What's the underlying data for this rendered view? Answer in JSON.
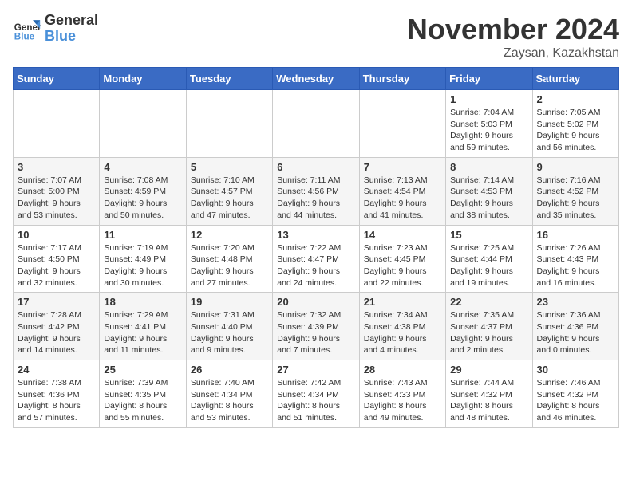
{
  "header": {
    "logo_line1": "General",
    "logo_line2": "Blue",
    "month": "November 2024",
    "location": "Zaysan, Kazakhstan"
  },
  "days_of_week": [
    "Sunday",
    "Monday",
    "Tuesday",
    "Wednesday",
    "Thursday",
    "Friday",
    "Saturday"
  ],
  "weeks": [
    [
      {
        "day": "",
        "info": ""
      },
      {
        "day": "",
        "info": ""
      },
      {
        "day": "",
        "info": ""
      },
      {
        "day": "",
        "info": ""
      },
      {
        "day": "",
        "info": ""
      },
      {
        "day": "1",
        "info": "Sunrise: 7:04 AM\nSunset: 5:03 PM\nDaylight: 9 hours and 59 minutes."
      },
      {
        "day": "2",
        "info": "Sunrise: 7:05 AM\nSunset: 5:02 PM\nDaylight: 9 hours and 56 minutes."
      }
    ],
    [
      {
        "day": "3",
        "info": "Sunrise: 7:07 AM\nSunset: 5:00 PM\nDaylight: 9 hours and 53 minutes."
      },
      {
        "day": "4",
        "info": "Sunrise: 7:08 AM\nSunset: 4:59 PM\nDaylight: 9 hours and 50 minutes."
      },
      {
        "day": "5",
        "info": "Sunrise: 7:10 AM\nSunset: 4:57 PM\nDaylight: 9 hours and 47 minutes."
      },
      {
        "day": "6",
        "info": "Sunrise: 7:11 AM\nSunset: 4:56 PM\nDaylight: 9 hours and 44 minutes."
      },
      {
        "day": "7",
        "info": "Sunrise: 7:13 AM\nSunset: 4:54 PM\nDaylight: 9 hours and 41 minutes."
      },
      {
        "day": "8",
        "info": "Sunrise: 7:14 AM\nSunset: 4:53 PM\nDaylight: 9 hours and 38 minutes."
      },
      {
        "day": "9",
        "info": "Sunrise: 7:16 AM\nSunset: 4:52 PM\nDaylight: 9 hours and 35 minutes."
      }
    ],
    [
      {
        "day": "10",
        "info": "Sunrise: 7:17 AM\nSunset: 4:50 PM\nDaylight: 9 hours and 32 minutes."
      },
      {
        "day": "11",
        "info": "Sunrise: 7:19 AM\nSunset: 4:49 PM\nDaylight: 9 hours and 30 minutes."
      },
      {
        "day": "12",
        "info": "Sunrise: 7:20 AM\nSunset: 4:48 PM\nDaylight: 9 hours and 27 minutes."
      },
      {
        "day": "13",
        "info": "Sunrise: 7:22 AM\nSunset: 4:47 PM\nDaylight: 9 hours and 24 minutes."
      },
      {
        "day": "14",
        "info": "Sunrise: 7:23 AM\nSunset: 4:45 PM\nDaylight: 9 hours and 22 minutes."
      },
      {
        "day": "15",
        "info": "Sunrise: 7:25 AM\nSunset: 4:44 PM\nDaylight: 9 hours and 19 minutes."
      },
      {
        "day": "16",
        "info": "Sunrise: 7:26 AM\nSunset: 4:43 PM\nDaylight: 9 hours and 16 minutes."
      }
    ],
    [
      {
        "day": "17",
        "info": "Sunrise: 7:28 AM\nSunset: 4:42 PM\nDaylight: 9 hours and 14 minutes."
      },
      {
        "day": "18",
        "info": "Sunrise: 7:29 AM\nSunset: 4:41 PM\nDaylight: 9 hours and 11 minutes."
      },
      {
        "day": "19",
        "info": "Sunrise: 7:31 AM\nSunset: 4:40 PM\nDaylight: 9 hours and 9 minutes."
      },
      {
        "day": "20",
        "info": "Sunrise: 7:32 AM\nSunset: 4:39 PM\nDaylight: 9 hours and 7 minutes."
      },
      {
        "day": "21",
        "info": "Sunrise: 7:34 AM\nSunset: 4:38 PM\nDaylight: 9 hours and 4 minutes."
      },
      {
        "day": "22",
        "info": "Sunrise: 7:35 AM\nSunset: 4:37 PM\nDaylight: 9 hours and 2 minutes."
      },
      {
        "day": "23",
        "info": "Sunrise: 7:36 AM\nSunset: 4:36 PM\nDaylight: 9 hours and 0 minutes."
      }
    ],
    [
      {
        "day": "24",
        "info": "Sunrise: 7:38 AM\nSunset: 4:36 PM\nDaylight: 8 hours and 57 minutes."
      },
      {
        "day": "25",
        "info": "Sunrise: 7:39 AM\nSunset: 4:35 PM\nDaylight: 8 hours and 55 minutes."
      },
      {
        "day": "26",
        "info": "Sunrise: 7:40 AM\nSunset: 4:34 PM\nDaylight: 8 hours and 53 minutes."
      },
      {
        "day": "27",
        "info": "Sunrise: 7:42 AM\nSunset: 4:34 PM\nDaylight: 8 hours and 51 minutes."
      },
      {
        "day": "28",
        "info": "Sunrise: 7:43 AM\nSunset: 4:33 PM\nDaylight: 8 hours and 49 minutes."
      },
      {
        "day": "29",
        "info": "Sunrise: 7:44 AM\nSunset: 4:32 PM\nDaylight: 8 hours and 48 minutes."
      },
      {
        "day": "30",
        "info": "Sunrise: 7:46 AM\nSunset: 4:32 PM\nDaylight: 8 hours and 46 minutes."
      }
    ]
  ]
}
